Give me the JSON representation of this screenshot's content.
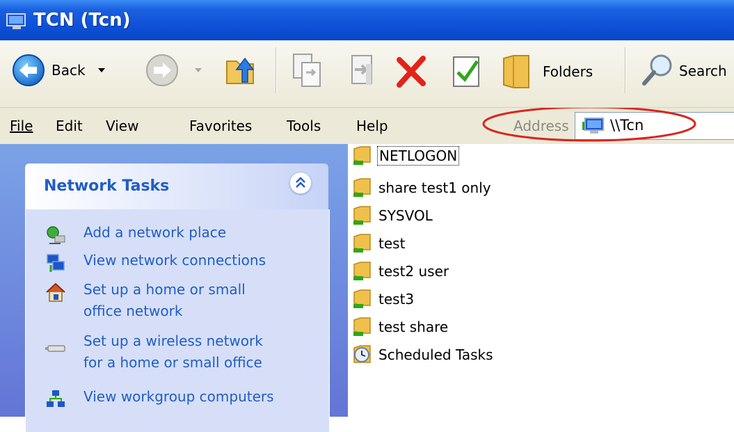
{
  "window": {
    "title": "TCN (Tcn)"
  },
  "toolbar": {
    "back_label": "Back",
    "folders_label": "Folders",
    "search_label": "Search"
  },
  "menu": [
    "File",
    "Edit",
    "View",
    "Favorites",
    "Tools",
    "Help"
  ],
  "address": {
    "label": "Address",
    "value": "\\\\Tcn"
  },
  "task_pane": {
    "title": "Network Tasks",
    "items": [
      {
        "label_lines": [
          "Add a network place"
        ],
        "icon": "network-place-icon"
      },
      {
        "label_lines": [
          "View network connections"
        ],
        "icon": "network-connections-icon"
      },
      {
        "label_lines": [
          "Set up a home or small",
          "office network"
        ],
        "icon": "home-network-icon"
      },
      {
        "label_lines": [
          "Set up a wireless network",
          "for a home or small office"
        ],
        "icon": "wireless-network-icon"
      },
      {
        "label_lines": [
          "View workgroup computers"
        ],
        "icon": "workgroup-computers-icon"
      }
    ]
  },
  "files": [
    {
      "name": "NETLOGON",
      "type": "shared-folder",
      "selected": true
    },
    {
      "name": "share test1 only",
      "type": "shared-folder"
    },
    {
      "name": "SYSVOL",
      "type": "shared-folder"
    },
    {
      "name": "test",
      "type": "shared-folder"
    },
    {
      "name": "test2 user",
      "type": "shared-folder"
    },
    {
      "name": "test3",
      "type": "shared-folder"
    },
    {
      "name": "test share",
      "type": "shared-folder"
    },
    {
      "name": "Scheduled Tasks",
      "type": "scheduled-tasks"
    }
  ],
  "colors": {
    "title_bar": "#0d4fd6",
    "link": "#215dc6",
    "annotation": "#d9261c",
    "pane_bg": "#6375d6"
  }
}
